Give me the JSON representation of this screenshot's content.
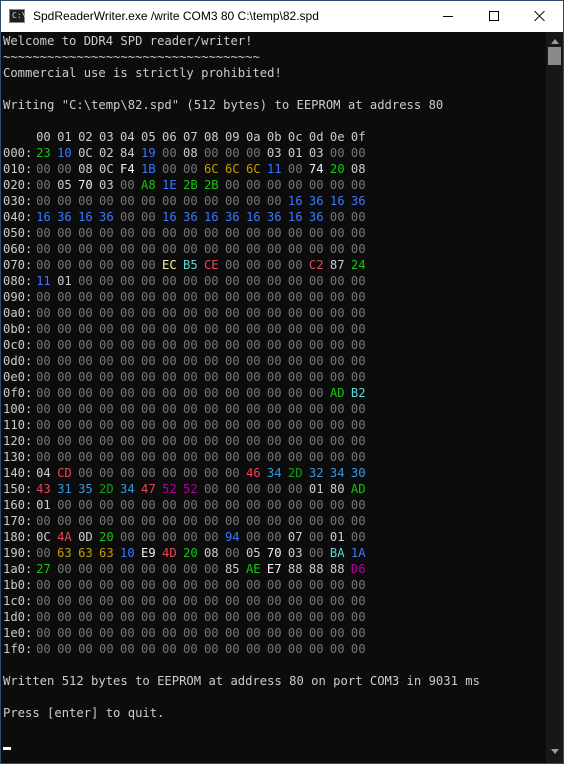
{
  "window": {
    "title": "SpdReaderWriter.exe  /write COM3 80 C:\\temp\\82.spd",
    "app_icon": "console-app-icon",
    "app_icon_glyph": "C:\\",
    "buttons": {
      "minimize": "minimize-icon",
      "maximize": "maximize-icon",
      "close": "close-icon"
    }
  },
  "colors": {
    "default": "#cccccc",
    "zero": "#767676",
    "white": "#f2f2f2",
    "blue": "#3b78ff",
    "green": "#16c60c",
    "yellow": "#f9f1a5",
    "cyan": "#61d6d6",
    "red": "#e74856",
    "magenta": "#b4009e",
    "darkgreen": "#13a10e",
    "darkyellow": "#c19c00",
    "darkcyan": "#3a96dd"
  },
  "console": {
    "lines_before": [
      "Welcome to DDR4 SPD reader/writer!",
      "~~~~~~~~~~~~~~~~~~~~~~~~~~~~~~~~~~~",
      "Commercial use is strictly prohibited!",
      "",
      "Writing \"C:\\temp\\82.spd\" (512 bytes) to EEPROM at address 80",
      ""
    ],
    "hex_header": [
      "00",
      "01",
      "02",
      "03",
      "04",
      "05",
      "06",
      "07",
      "08",
      "09",
      "0a",
      "0b",
      "0c",
      "0d",
      "0e",
      "0f"
    ],
    "hex_rows": [
      {
        "addr": "000:",
        "bytes": [
          "23:green",
          "10:blue",
          "0C:default",
          "02:default",
          "84:default",
          "19:blue",
          "00",
          "08:default",
          "00",
          "00",
          "00",
          "03:default",
          "01:default",
          "03:default",
          "00",
          "00"
        ]
      },
      {
        "addr": "010:",
        "bytes": [
          "00",
          "00",
          "08:default",
          "0C:default",
          "F4:white",
          "1B:blue",
          "00",
          "00",
          "6C:darkyellow",
          "6C:darkyellow",
          "6C:darkyellow",
          "11:blue",
          "00",
          "74:white",
          "20:green",
          "08:default"
        ]
      },
      {
        "addr": "020:",
        "bytes": [
          "00",
          "05:default",
          "70:white",
          "03:default",
          "00",
          "A8:green",
          "1E:blue",
          "2B:green",
          "2B:green",
          "00",
          "00",
          "00",
          "00",
          "00",
          "00",
          "00"
        ]
      },
      {
        "addr": "030:",
        "bytes": [
          "00",
          "00",
          "00",
          "00",
          "00",
          "00",
          "00",
          "00",
          "00",
          "00",
          "00",
          "00",
          "16:blue",
          "36:blue",
          "16:blue",
          "36:blue"
        ]
      },
      {
        "addr": "040:",
        "bytes": [
          "16:blue",
          "36:blue",
          "16:blue",
          "36:blue",
          "00",
          "00",
          "16:blue",
          "36:blue",
          "16:blue",
          "36:blue",
          "16:blue",
          "36:blue",
          "16:blue",
          "36:blue",
          "00",
          "00"
        ]
      },
      {
        "addr": "050:",
        "bytes": [
          "00",
          "00",
          "00",
          "00",
          "00",
          "00",
          "00",
          "00",
          "00",
          "00",
          "00",
          "00",
          "00",
          "00",
          "00",
          "00"
        ]
      },
      {
        "addr": "060:",
        "bytes": [
          "00",
          "00",
          "00",
          "00",
          "00",
          "00",
          "00",
          "00",
          "00",
          "00",
          "00",
          "00",
          "00",
          "00",
          "00",
          "00"
        ]
      },
      {
        "addr": "070:",
        "bytes": [
          "00",
          "00",
          "00",
          "00",
          "00",
          "00",
          "EC:yellow",
          "B5:cyan",
          "CE:red",
          "00",
          "00",
          "00",
          "00",
          "C2:red",
          "87:default",
          "24:green"
        ]
      },
      {
        "addr": "080:",
        "bytes": [
          "11:blue",
          "01:default",
          "00",
          "00",
          "00",
          "00",
          "00",
          "00",
          "00",
          "00",
          "00",
          "00",
          "00",
          "00",
          "00",
          "00"
        ]
      },
      {
        "addr": "090:",
        "bytes": [
          "00",
          "00",
          "00",
          "00",
          "00",
          "00",
          "00",
          "00",
          "00",
          "00",
          "00",
          "00",
          "00",
          "00",
          "00",
          "00"
        ]
      },
      {
        "addr": "0a0:",
        "bytes": [
          "00",
          "00",
          "00",
          "00",
          "00",
          "00",
          "00",
          "00",
          "00",
          "00",
          "00",
          "00",
          "00",
          "00",
          "00",
          "00"
        ]
      },
      {
        "addr": "0b0:",
        "bytes": [
          "00",
          "00",
          "00",
          "00",
          "00",
          "00",
          "00",
          "00",
          "00",
          "00",
          "00",
          "00",
          "00",
          "00",
          "00",
          "00"
        ]
      },
      {
        "addr": "0c0:",
        "bytes": [
          "00",
          "00",
          "00",
          "00",
          "00",
          "00",
          "00",
          "00",
          "00",
          "00",
          "00",
          "00",
          "00",
          "00",
          "00",
          "00"
        ]
      },
      {
        "addr": "0d0:",
        "bytes": [
          "00",
          "00",
          "00",
          "00",
          "00",
          "00",
          "00",
          "00",
          "00",
          "00",
          "00",
          "00",
          "00",
          "00",
          "00",
          "00"
        ]
      },
      {
        "addr": "0e0:",
        "bytes": [
          "00",
          "00",
          "00",
          "00",
          "00",
          "00",
          "00",
          "00",
          "00",
          "00",
          "00",
          "00",
          "00",
          "00",
          "00",
          "00"
        ]
      },
      {
        "addr": "0f0:",
        "bytes": [
          "00",
          "00",
          "00",
          "00",
          "00",
          "00",
          "00",
          "00",
          "00",
          "00",
          "00",
          "00",
          "00",
          "00",
          "AD:green",
          "B2:cyan"
        ]
      },
      {
        "addr": "100:",
        "bytes": [
          "00",
          "00",
          "00",
          "00",
          "00",
          "00",
          "00",
          "00",
          "00",
          "00",
          "00",
          "00",
          "00",
          "00",
          "00",
          "00"
        ]
      },
      {
        "addr": "110:",
        "bytes": [
          "00",
          "00",
          "00",
          "00",
          "00",
          "00",
          "00",
          "00",
          "00",
          "00",
          "00",
          "00",
          "00",
          "00",
          "00",
          "00"
        ]
      },
      {
        "addr": "120:",
        "bytes": [
          "00",
          "00",
          "00",
          "00",
          "00",
          "00",
          "00",
          "00",
          "00",
          "00",
          "00",
          "00",
          "00",
          "00",
          "00",
          "00"
        ]
      },
      {
        "addr": "130:",
        "bytes": [
          "00",
          "00",
          "00",
          "00",
          "00",
          "00",
          "00",
          "00",
          "00",
          "00",
          "00",
          "00",
          "00",
          "00",
          "00",
          "00"
        ]
      },
      {
        "addr": "140:",
        "bytes": [
          "04:default",
          "CD:red",
          "00",
          "00",
          "00",
          "00",
          "00",
          "00",
          "00",
          "00",
          "46:red",
          "34:darkcyan",
          "2D:darkgreen",
          "32:darkcyan",
          "34:darkcyan",
          "30:darkcyan"
        ]
      },
      {
        "addr": "150:",
        "bytes": [
          "43:red",
          "31:darkcyan",
          "35:darkcyan",
          "2D:darkgreen",
          "34:darkcyan",
          "47:red",
          "52:magenta",
          "52:magenta",
          "00",
          "00",
          "00",
          "00",
          "00",
          "01:default",
          "80:default",
          "AD:green"
        ]
      },
      {
        "addr": "160:",
        "bytes": [
          "01:default",
          "00",
          "00",
          "00",
          "00",
          "00",
          "00",
          "00",
          "00",
          "00",
          "00",
          "00",
          "00",
          "00",
          "00",
          "00"
        ]
      },
      {
        "addr": "170:",
        "bytes": [
          "00",
          "00",
          "00",
          "00",
          "00",
          "00",
          "00",
          "00",
          "00",
          "00",
          "00",
          "00",
          "00",
          "00",
          "00",
          "00"
        ]
      },
      {
        "addr": "180:",
        "bytes": [
          "0C:default",
          "4A:red",
          "0D:default",
          "20:green",
          "00",
          "00",
          "00",
          "00",
          "00",
          "94:blue",
          "00",
          "00",
          "07:default",
          "00",
          "01:default",
          "00"
        ]
      },
      {
        "addr": "190:",
        "bytes": [
          "00",
          "63:darkyellow",
          "63:darkyellow",
          "63:darkyellow",
          "10:blue",
          "E9:white",
          "4D:red",
          "20:green",
          "08:default",
          "00",
          "05:default",
          "70:white",
          "03:default",
          "00",
          "BA:cyan",
          "1A:blue"
        ]
      },
      {
        "addr": "1a0:",
        "bytes": [
          "27:green",
          "00",
          "00",
          "00",
          "00",
          "00",
          "00",
          "00",
          "00",
          "85:default",
          "AE:green",
          "E7:white",
          "88:default",
          "88:default",
          "88:default",
          "D6:magenta"
        ]
      },
      {
        "addr": "1b0:",
        "bytes": [
          "00",
          "00",
          "00",
          "00",
          "00",
          "00",
          "00",
          "00",
          "00",
          "00",
          "00",
          "00",
          "00",
          "00",
          "00",
          "00"
        ]
      },
      {
        "addr": "1c0:",
        "bytes": [
          "00",
          "00",
          "00",
          "00",
          "00",
          "00",
          "00",
          "00",
          "00",
          "00",
          "00",
          "00",
          "00",
          "00",
          "00",
          "00"
        ]
      },
      {
        "addr": "1d0:",
        "bytes": [
          "00",
          "00",
          "00",
          "00",
          "00",
          "00",
          "00",
          "00",
          "00",
          "00",
          "00",
          "00",
          "00",
          "00",
          "00",
          "00"
        ]
      },
      {
        "addr": "1e0:",
        "bytes": [
          "00",
          "00",
          "00",
          "00",
          "00",
          "00",
          "00",
          "00",
          "00",
          "00",
          "00",
          "00",
          "00",
          "00",
          "00",
          "00"
        ]
      },
      {
        "addr": "1f0:",
        "bytes": [
          "00",
          "00",
          "00",
          "00",
          "00",
          "00",
          "00",
          "00",
          "00",
          "00",
          "00",
          "00",
          "00",
          "00",
          "00",
          "00"
        ]
      }
    ],
    "lines_after": [
      "",
      "Written 512 bytes to EEPROM at address 80 on port COM3 in 9031 ms",
      "",
      "Press [enter] to quit."
    ]
  },
  "scrollbar": {
    "up_icon": "scroll-up-arrow-icon",
    "down_icon": "scroll-down-arrow-icon"
  }
}
